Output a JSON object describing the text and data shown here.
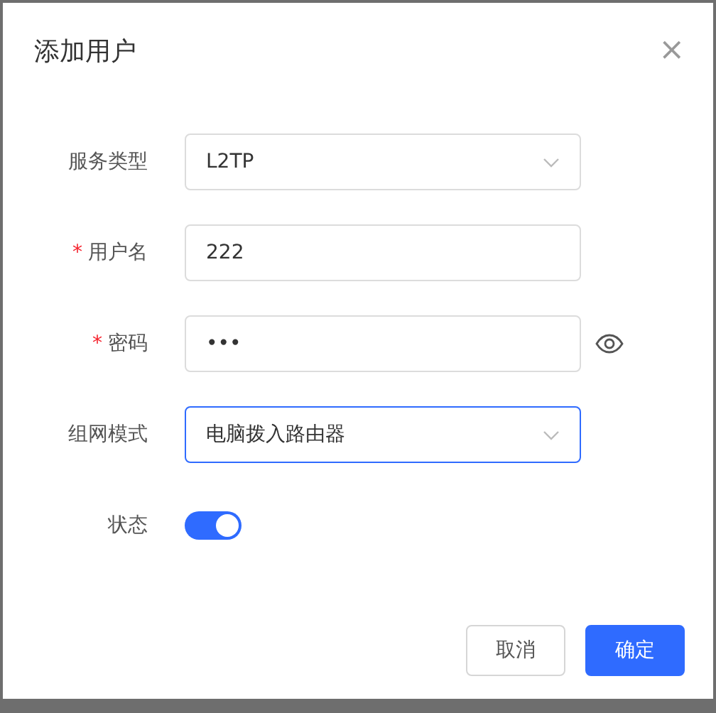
{
  "dialog": {
    "title": "添加用户",
    "close": "×"
  },
  "fields": [
    {
      "kind": "select",
      "label": "服务类型",
      "value": "L2TP",
      "focused": false
    },
    {
      "kind": "text",
      "label": "用户名",
      "required_mark": "*",
      "value": "222",
      "focused": false
    },
    {
      "kind": "password",
      "label": "密码",
      "required_mark": "*",
      "value": "•••",
      "focused": false
    },
    {
      "kind": "select",
      "label": "组网模式",
      "value": "电脑拨入路由器",
      "focused": true
    },
    {
      "kind": "switch",
      "label": "状态",
      "on": true
    }
  ],
  "buttons": [
    {
      "label": "取消",
      "primary": false
    },
    {
      "label": "确定",
      "primary": true
    }
  ]
}
